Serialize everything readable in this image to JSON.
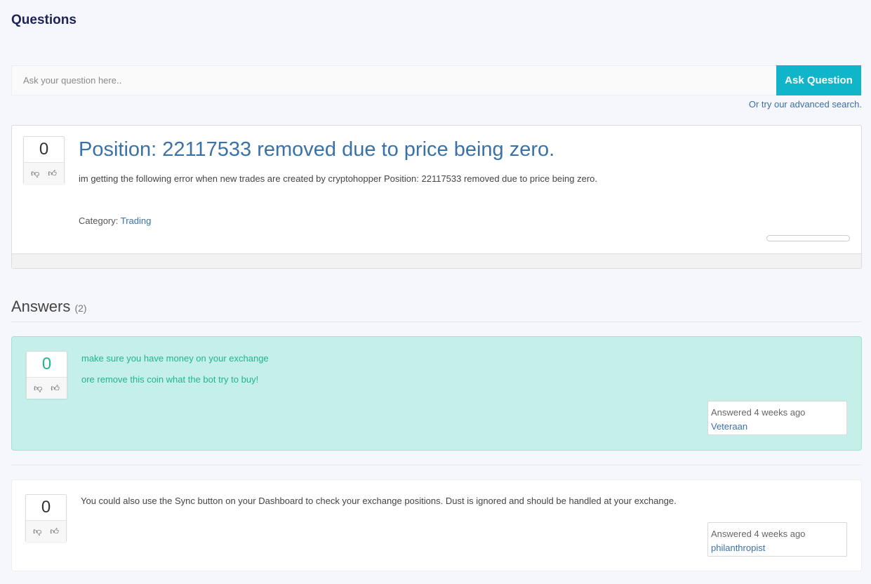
{
  "page": {
    "title": "Questions"
  },
  "ask": {
    "placeholder": "Ask your question here..",
    "button_label": "Ask Question",
    "advanced_search": "Or try our advanced search."
  },
  "question": {
    "votes": "0",
    "title": "Position: 22117533 removed due to price being zero.",
    "body": "im getting the following error when new trades are created by cryptohopper   Position: 22117533 removed due to price being zero.",
    "category_label": "Category:",
    "category": "Trading"
  },
  "answers": {
    "heading": "Answers",
    "count": "(2)",
    "items": [
      {
        "votes": "0",
        "lines": [
          "make sure you have money on your exchange",
          "ore remove this coin what the bot try to buy!"
        ],
        "answered": "Answered 4 weeks ago",
        "author": "Veteraan",
        "accepted": true
      },
      {
        "votes": "0",
        "lines": [
          "You could also use the Sync button on your Dashboard to check your exchange positions. Dust is ignored and should be handled at your exchange."
        ],
        "answered": "Answered 4 weeks ago",
        "author": "philanthropist",
        "accepted": false
      }
    ]
  },
  "icons": {
    "downvote": "thumbs-down-icon",
    "upvote": "thumbs-up-icon"
  },
  "colors": {
    "accent": "#10b5c9",
    "link": "#3a72a8",
    "accepted_bg": "#c5efe9",
    "accepted_text": "#1fb58d"
  }
}
